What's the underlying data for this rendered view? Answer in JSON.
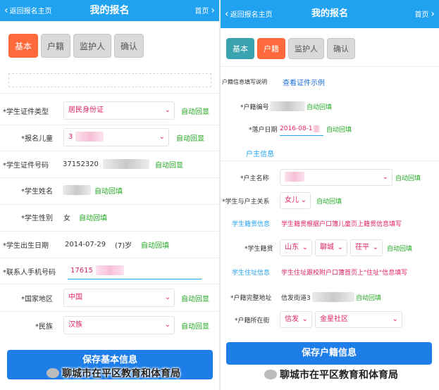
{
  "left": {
    "header": {
      "back_label": "返回报名主页",
      "title": "我的报名",
      "home_label": "首页"
    },
    "tabs": [
      "基本",
      "户籍",
      "监护人",
      "确认"
    ],
    "fields": {
      "id_type": {
        "label": "*学生证件类型",
        "value": "居民身份证",
        "auto": "自动回显"
      },
      "child": {
        "label": "*报名儿童",
        "value": "3",
        "auto": "自动回显"
      },
      "id_no": {
        "label": "*学生证件号码",
        "value": "37152320",
        "auto": "自动回显"
      },
      "name": {
        "label": "*学生姓名",
        "auto": "自动回填"
      },
      "gender": {
        "label": "*学生性别",
        "value": "女",
        "auto": "自动回填"
      },
      "birth": {
        "label": "*学生出生日期",
        "value": "2014-07-29",
        "age": "(7)岁",
        "auto": "自动回填"
      },
      "phone": {
        "label": "*联系人手机号码",
        "value": "17615"
      },
      "region": {
        "label": "*国家地区",
        "value": "中国",
        "auto": "自动回显"
      },
      "ethnic": {
        "label": "*民族",
        "value": "汉族",
        "auto": "自动回显"
      }
    },
    "save_button": "保存基本信息",
    "watermark": "聊城市在平区教育和体育局"
  },
  "right": {
    "header": {
      "back_label": "返回报名主页",
      "title": "我的报名",
      "home_label": "首页"
    },
    "tabs": [
      "基本",
      "户籍",
      "监护人",
      "确认"
    ],
    "fields": {
      "fill_note": {
        "label": "户籍信息填写说明",
        "link": "查看证件示例"
      },
      "hukou_no": {
        "label": "*户籍编号",
        "auto": "自动回填"
      },
      "settle_date": {
        "label": "*落户日期",
        "value": "2016-08-1",
        "auto": "自动回填"
      },
      "owner_section": "户主信息",
      "owner_name": {
        "label": "*户主名称",
        "auto": "自动回填"
      },
      "relation": {
        "label": "*学生与户主关系",
        "value": "女儿",
        "auto": "自动回填"
      },
      "origin_section": "学生籍贯信息",
      "origin_note": "学生籍贯根据户口簿儿童页上籍贯信息填写",
      "origin": {
        "label": "*学生籍贯",
        "province": "山东",
        "city": "聊城",
        "county": "茌平",
        "auto": "自动回填"
      },
      "address_section": "学生住址信息",
      "address_note": "学生住址跟校附户口簿首页上\"住址\"信息填写",
      "address": {
        "label": "*户籍完整地址",
        "value": "信发街道3",
        "auto": "自动回填"
      },
      "location": {
        "label": "*户籍所在街",
        "town": "信发",
        "detail": "金星社区"
      }
    },
    "save_button": "保存户籍信息",
    "watermark": "聊城市在平区教育和体育局"
  }
}
